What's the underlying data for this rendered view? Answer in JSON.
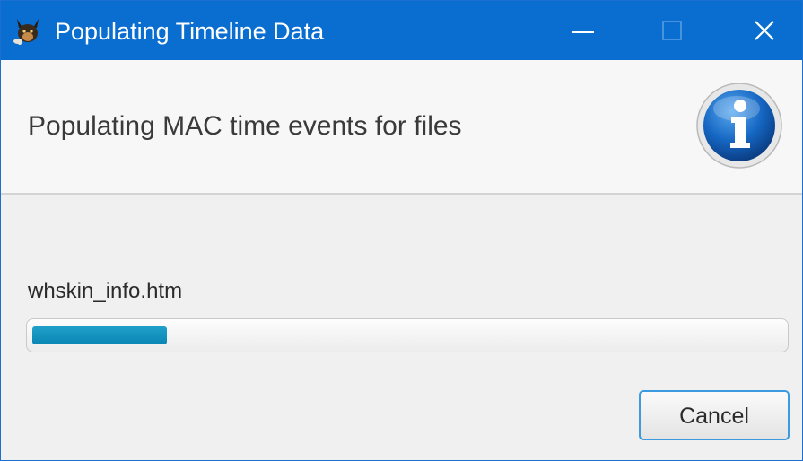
{
  "window": {
    "title": "Populating Timeline Data",
    "app_icon": "autopsy-dog-icon",
    "controls": {
      "minimize_icon": "minimize-icon",
      "maximize_icon": "maximize-icon",
      "close_icon": "close-icon"
    },
    "titlebar_color": "#0a6ed1"
  },
  "header": {
    "message": "Populating MAC time events for files",
    "icon": "info-icon"
  },
  "progress": {
    "current_item": "whskin_info.htm",
    "fraction": 0.18,
    "fill_color": "#0b86b4"
  },
  "buttons": {
    "cancel_label": "Cancel"
  }
}
